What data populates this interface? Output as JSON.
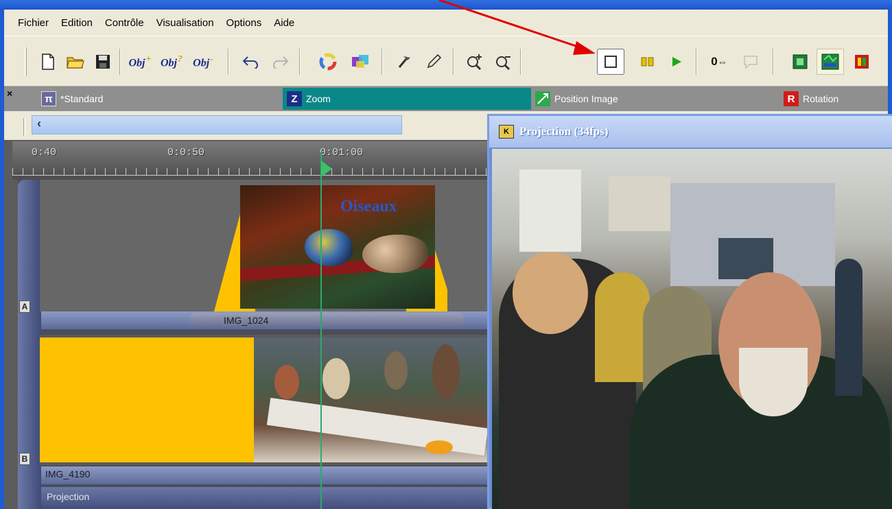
{
  "menu": {
    "items": [
      "Fichier",
      "Edition",
      "Contrôle",
      "Visualisation",
      "Options",
      "Aide"
    ]
  },
  "toolbar": {
    "obj_label": "Obj",
    "obj_add_sup": "+",
    "obj_prop_sup": "?",
    "obj_del_sup": "-",
    "counter_label": "0"
  },
  "effects": {
    "standard_label": "*Standard",
    "zoom_label": "Zoom",
    "position_label": "Position Image",
    "rotation_label": "Rotation",
    "standard_icon_letter": "π",
    "zoom_icon_letter": "Z",
    "rotation_icon_letter": "R"
  },
  "timeline": {
    "ruler_labels": [
      "0:40",
      "0:0:50",
      "0:01:00"
    ],
    "track_a_letter": "A",
    "track_b_letter": "B",
    "clip_a_name": "IMG_1024",
    "clip_a_title": "Oiseaux",
    "clip_b_name": "IMG_4190",
    "projection_label": "Projection"
  },
  "projection": {
    "title": "Projection (34fps)",
    "icon_letter": "K"
  },
  "colors": {
    "accent_yellow": "#ffc200",
    "zoom_tab": "#0a8888",
    "arrow": "#e00000",
    "playhead": "#2fa86f"
  },
  "icons": [
    "new-file-icon",
    "open-folder-icon",
    "save-icon",
    "undo-icon",
    "redo-icon",
    "stop-icon",
    "pause-icon",
    "play-icon",
    "zoom-in-icon",
    "zoom-out-icon"
  ]
}
